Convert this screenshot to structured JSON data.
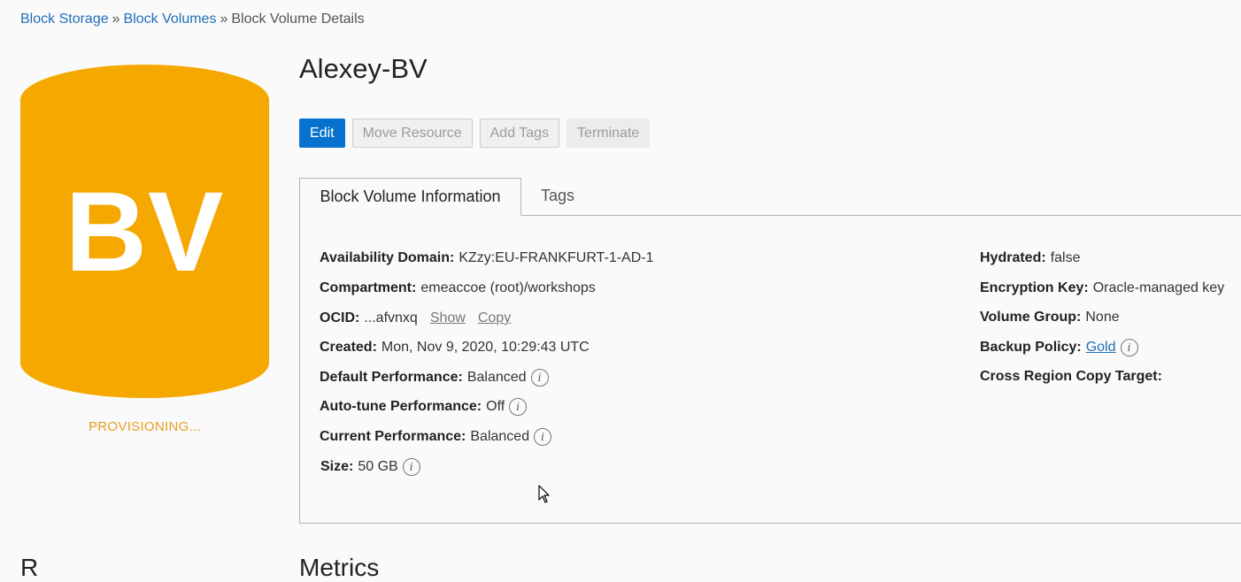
{
  "breadcrumb": {
    "items": [
      "Block Storage",
      "Block Volumes"
    ],
    "separator": "»",
    "current": "Block Volume Details"
  },
  "resource_icon": {
    "letters": "BV",
    "color": "#f5a800",
    "status": "PROVISIONING..."
  },
  "page_title": "Alexey-BV",
  "actions": {
    "edit": "Edit",
    "move_resource": "Move Resource",
    "add_tags": "Add Tags",
    "terminate": "Terminate"
  },
  "tabs": {
    "info": "Block Volume Information",
    "tags": "Tags"
  },
  "details": {
    "availability_domain": {
      "label": "Availability Domain:",
      "value": "KZzy:EU-FRANKFURT-1-AD-1"
    },
    "compartment": {
      "label": "Compartment:",
      "value": "emeaccoe (root)/workshops"
    },
    "ocid": {
      "label": "OCID:",
      "value": "...afvnxq",
      "show": "Show",
      "copy": "Copy"
    },
    "created": {
      "label": "Created:",
      "value": "Mon, Nov 9, 2020, 10:29:43 UTC"
    },
    "default_performance": {
      "label": "Default Performance:",
      "value": "Balanced"
    },
    "auto_tune_performance": {
      "label": "Auto-tune Performance:",
      "value": "Off"
    },
    "current_performance": {
      "label": "Current Performance:",
      "value": "Balanced"
    },
    "size": {
      "label": "Size:",
      "value": "50 GB"
    },
    "hydrated": {
      "label": "Hydrated:",
      "value": "false"
    },
    "encryption_key": {
      "label": "Encryption Key:",
      "value": "Oracle-managed key"
    },
    "volume_group": {
      "label": "Volume Group:",
      "value": "None"
    },
    "backup_policy": {
      "label": "Backup Policy:",
      "value": "Gold"
    },
    "cross_region_copy_target": {
      "label": "Cross Region Copy Target:",
      "value": ""
    }
  },
  "info_glyph": "i",
  "bottom": {
    "left_heading": "R",
    "right_heading": "Metrics"
  },
  "colors": {
    "primary": "#0572ce",
    "link": "#1f6fb8",
    "status": "#e6a023"
  },
  "icons": {
    "info": "info-icon",
    "cursor": "mouse-pointer-icon"
  }
}
